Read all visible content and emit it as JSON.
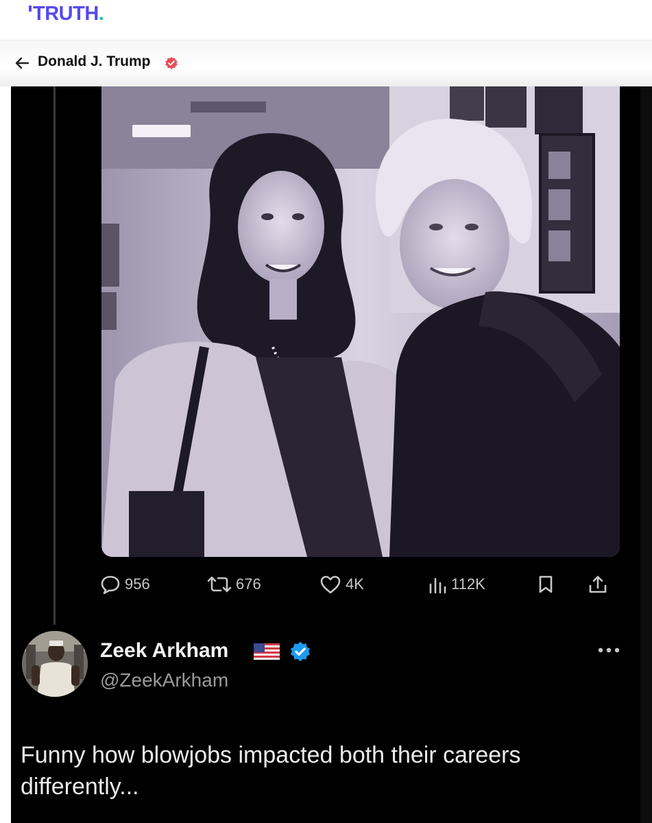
{
  "app": {
    "logo_text": "TRUTH",
    "logo_dot": ".",
    "brand_color": "#5448ee",
    "accent_color": "#19c3a5"
  },
  "profile_header": {
    "back_icon": "arrow-left-icon",
    "name": "Donald J. Trump",
    "verified_icon": "verified-badge-icon",
    "verified_color": "#e94b5a"
  },
  "embedded_post": {
    "image": "photo-two-women-smiling",
    "stats": {
      "replies": "956",
      "reposts": "676",
      "likes": "4K",
      "views": "112K"
    },
    "icons": [
      "comment-icon",
      "repost-icon",
      "heart-icon",
      "views-icon",
      "bookmark-icon",
      "share-icon"
    ]
  },
  "reply": {
    "name": "Zeek Arkham",
    "flag": "us-flag-icon",
    "verified_icon": "verified-badge-icon",
    "verified_color": "#1d9bf0",
    "handle": "@ZeekArkham",
    "more_icon": "more-dots-icon",
    "text": "Funny how blowjobs impacted both their careers differently..."
  }
}
